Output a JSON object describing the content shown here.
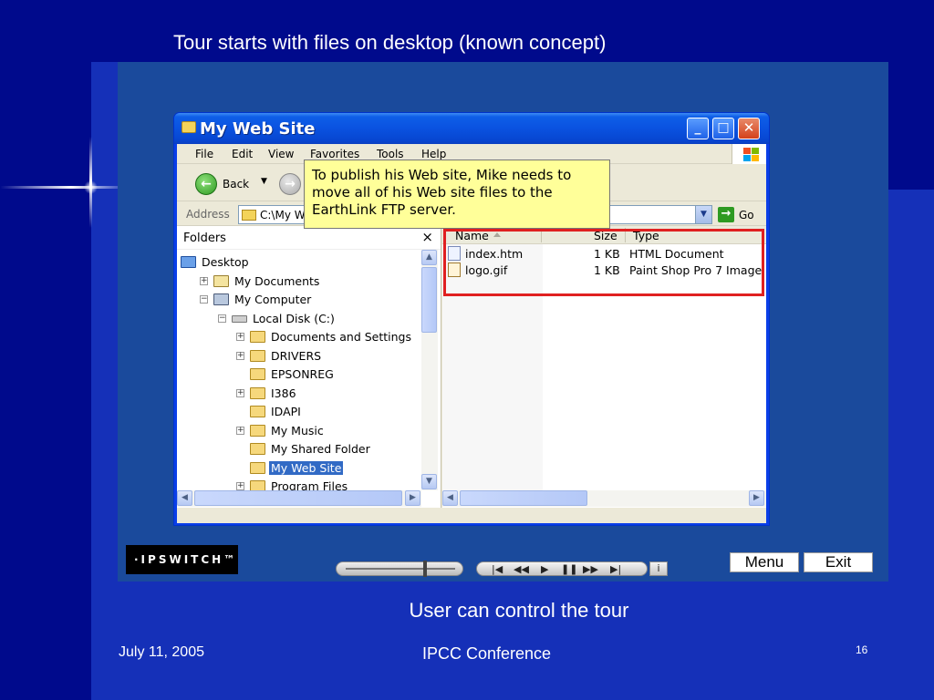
{
  "slide": {
    "title": "Tour starts with files on desktop (known concept)",
    "caption": "User can control the tour",
    "date": "July 11, 2005",
    "conference": "IPCC Conference",
    "page": "16"
  },
  "window": {
    "title": "My Web Site",
    "menu": [
      "File",
      "Edit",
      "View",
      "Favorites",
      "Tools",
      "Help"
    ],
    "back_label": "Back",
    "address_label": "Address",
    "address_value": "C:\\My W",
    "go_label": "Go"
  },
  "tooltip": {
    "text": "To publish his Web site, Mike needs to move all of his Web site files to the EarthLink FTP server."
  },
  "folders": {
    "title": "Folders",
    "close": "×",
    "tree": [
      {
        "label": "Desktop",
        "level": 0,
        "expander": "",
        "icon": "desk"
      },
      {
        "label": "My Documents",
        "level": 1,
        "expander": "+",
        "icon": "docs"
      },
      {
        "label": "My Computer",
        "level": 1,
        "expander": "−",
        "icon": "comp"
      },
      {
        "label": "Local Disk (C:)",
        "level": 2,
        "expander": "−",
        "icon": "disk"
      },
      {
        "label": "Documents and Settings",
        "level": 3,
        "expander": "+",
        "icon": "folder"
      },
      {
        "label": "DRIVERS",
        "level": 3,
        "expander": "+",
        "icon": "folder"
      },
      {
        "label": "EPSONREG",
        "level": 3,
        "expander": "",
        "icon": "folder"
      },
      {
        "label": "I386",
        "level": 3,
        "expander": "+",
        "icon": "folder"
      },
      {
        "label": "IDAPI",
        "level": 3,
        "expander": "",
        "icon": "folder"
      },
      {
        "label": "My Music",
        "level": 3,
        "expander": "+",
        "icon": "folder"
      },
      {
        "label": "My Shared Folder",
        "level": 3,
        "expander": "",
        "icon": "folder"
      },
      {
        "label": "My Web Site",
        "level": 3,
        "expander": "",
        "icon": "folder",
        "selected": true
      },
      {
        "label": "Program Files",
        "level": 3,
        "expander": "+",
        "icon": "folder"
      }
    ]
  },
  "files": {
    "columns": {
      "name": "Name",
      "size": "Size",
      "type": "Type"
    },
    "rows": [
      {
        "name": "index.htm",
        "size": "1 KB",
        "type": "HTML Document",
        "icon": "htm"
      },
      {
        "name": "logo.gif",
        "size": "1 KB",
        "type": "Paint Shop Pro 7 Image",
        "icon": "gif"
      }
    ]
  },
  "player": {
    "brand": "·IPSWITCH™",
    "menu_label": "Menu",
    "exit_label": "Exit",
    "info_label": "i"
  }
}
